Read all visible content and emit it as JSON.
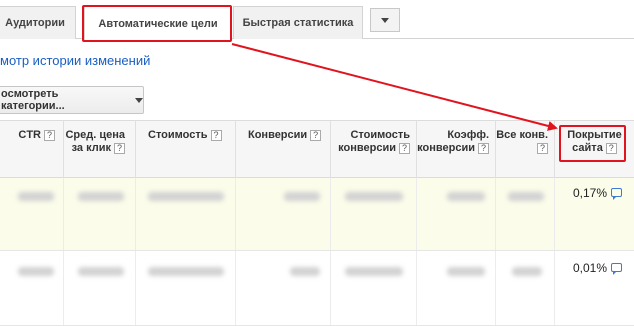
{
  "tabs": [
    {
      "label": "Аудитории",
      "active": false
    },
    {
      "label": "Автоматические цели",
      "active": true
    },
    {
      "label": "Быстрая статистика",
      "active": false
    }
  ],
  "more_tabs_icon": "chevron-down-icon",
  "history_link": "мотр истории изменений",
  "category_button": "осмотреть категории...",
  "table": {
    "headers": [
      {
        "label": "CTR",
        "help": "?"
      },
      {
        "label": "Сред. цена за клик",
        "help": "?"
      },
      {
        "label": "Стоимость",
        "help": "?"
      },
      {
        "label": "Конверсии",
        "help": "?"
      },
      {
        "label": "Стоимость конверсии",
        "help": "?"
      },
      {
        "label": "Коэфф. конверсии",
        "help": "?"
      },
      {
        "label": "Все конв.",
        "help": "?"
      },
      {
        "label": "Покрытие сайта",
        "help": "?"
      }
    ],
    "rows": [
      {
        "site_coverage": "0,17%",
        "comment_icon": "comment-icon"
      },
      {
        "site_coverage": "0,01%",
        "comment_icon": "comment-icon"
      }
    ]
  },
  "colors": {
    "highlight": "#e0141e",
    "link": "#1a5ec2",
    "selected_row": "#fbfcea"
  }
}
